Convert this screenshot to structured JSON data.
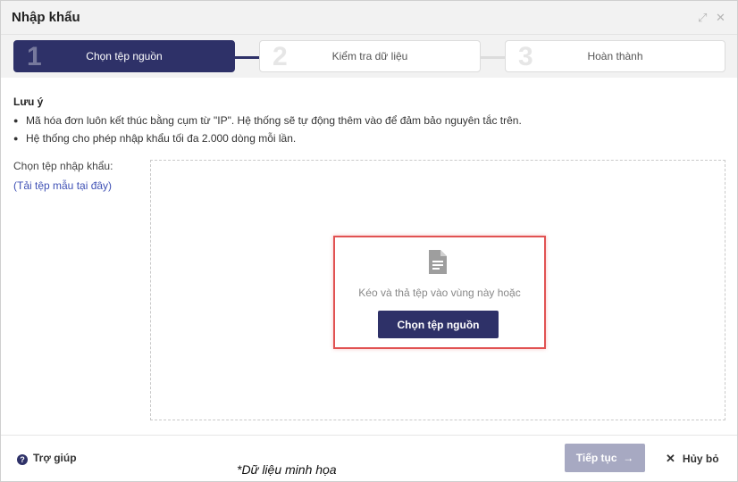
{
  "dialog": {
    "title": "Nhập khẩu"
  },
  "steps": [
    {
      "number": "1",
      "label": "Chọn tệp nguồn",
      "active": true
    },
    {
      "number": "2",
      "label": "Kiểm tra dữ liệu",
      "active": false
    },
    {
      "number": "3",
      "label": "Hoàn thành",
      "active": false
    }
  ],
  "notes": {
    "title": "Lưu ý",
    "items": [
      "Mã hóa đơn luôn kết thúc bằng cụm từ \"IP\". Hệ thống sẽ tự động thêm vào để đảm bảo nguyên tắc trên.",
      "Hệ thống cho phép nhập khẩu tối đa 2.000 dòng mỗi lần."
    ]
  },
  "picker": {
    "label": "Chọn tệp nhập khẩu:",
    "template_link": "(Tải tệp mẫu tại đây)",
    "drop_text": "Kéo và thả tệp vào vùng này hoặc",
    "button_label": "Chọn tệp nguồn"
  },
  "footer": {
    "help_label": "Trợ giúp",
    "demo_note": "*Dữ liệu minh họa",
    "continue_label": "Tiếp tục",
    "continue_arrow": "→",
    "cancel_label": "Hủy bỏ"
  },
  "icons": {
    "expand": "expand-icon",
    "close": "close-icon",
    "file": "file-document-icon",
    "help": "help-circle-icon",
    "arrow": "arrow-right-icon",
    "cancel": "x-icon"
  },
  "colors": {
    "primary": "#2e3168",
    "primary_disabled": "#a7a9c2",
    "link": "#3f51b5",
    "highlight": "#e15252"
  }
}
